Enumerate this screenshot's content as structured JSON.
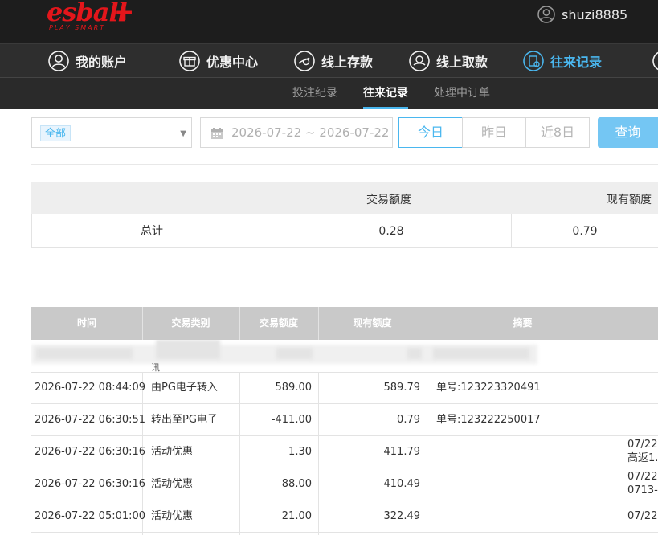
{
  "brand": {
    "logo_text": "esball",
    "logo_sub": "PLAY SMART"
  },
  "user": {
    "username": "shuzi8885"
  },
  "main_nav": [
    {
      "label": "我的账户",
      "icon": "user-icon",
      "active": false
    },
    {
      "label": "优惠中心",
      "icon": "gift-icon",
      "active": false
    },
    {
      "label": "线上存款",
      "icon": "deposit-icon",
      "active": false
    },
    {
      "label": "线上取款",
      "icon": "withdraw-icon",
      "active": false
    },
    {
      "label": "往来记录",
      "icon": "records-icon",
      "active": true
    }
  ],
  "sub_nav": [
    {
      "label": "投注纪录",
      "active": false
    },
    {
      "label": "往来记录",
      "active": true
    },
    {
      "label": "处理中订单",
      "active": false
    }
  ],
  "filters": {
    "type_select": "全部",
    "date_range": "2026-07-22 ~ 2026-07-22",
    "quick_ranges": [
      "今日",
      "昨日",
      "近8日"
    ],
    "active_range": "今日",
    "query_button": "查询"
  },
  "summary": {
    "headers": [
      "交易额度",
      "现有额度"
    ],
    "row_label": "总计",
    "values": [
      "0.28",
      "0.79"
    ]
  },
  "table": {
    "headers": [
      "时间",
      "交易类别",
      "交易额度",
      "现有额度",
      "摘要"
    ],
    "partial_row_text": "讯",
    "rows": [
      {
        "time": "2026-07-22 08:44:09",
        "type": "由PG电子转入",
        "amount": "589.00",
        "balance": "589.79",
        "summary": "单号:123223320491",
        "extra": ""
      },
      {
        "time": "2026-07-22 06:30:51",
        "type": "转出至PG电子",
        "amount": "-411.00",
        "balance": "0.79",
        "summary": "单号:123222250017",
        "extra": ""
      },
      {
        "time": "2026-07-22 06:30:16",
        "type": "活动优惠",
        "amount": "1.30",
        "balance": "411.79",
        "summary": "",
        "extra": "07/22\n高返1."
      },
      {
        "time": "2026-07-22 06:30:16",
        "type": "活动优惠",
        "amount": "88.00",
        "balance": "410.49",
        "summary": "",
        "extra": "07/22\n0713-"
      },
      {
        "time": "2026-07-22 05:01:00",
        "type": "活动优惠",
        "amount": "21.00",
        "balance": "322.49",
        "summary": "",
        "extra": "07/22"
      }
    ]
  },
  "colors": {
    "accent": "#4ab7ef",
    "brand_red": "#e3161b",
    "topbar": "#1d1d1d",
    "nav": "#2e2e2e"
  }
}
